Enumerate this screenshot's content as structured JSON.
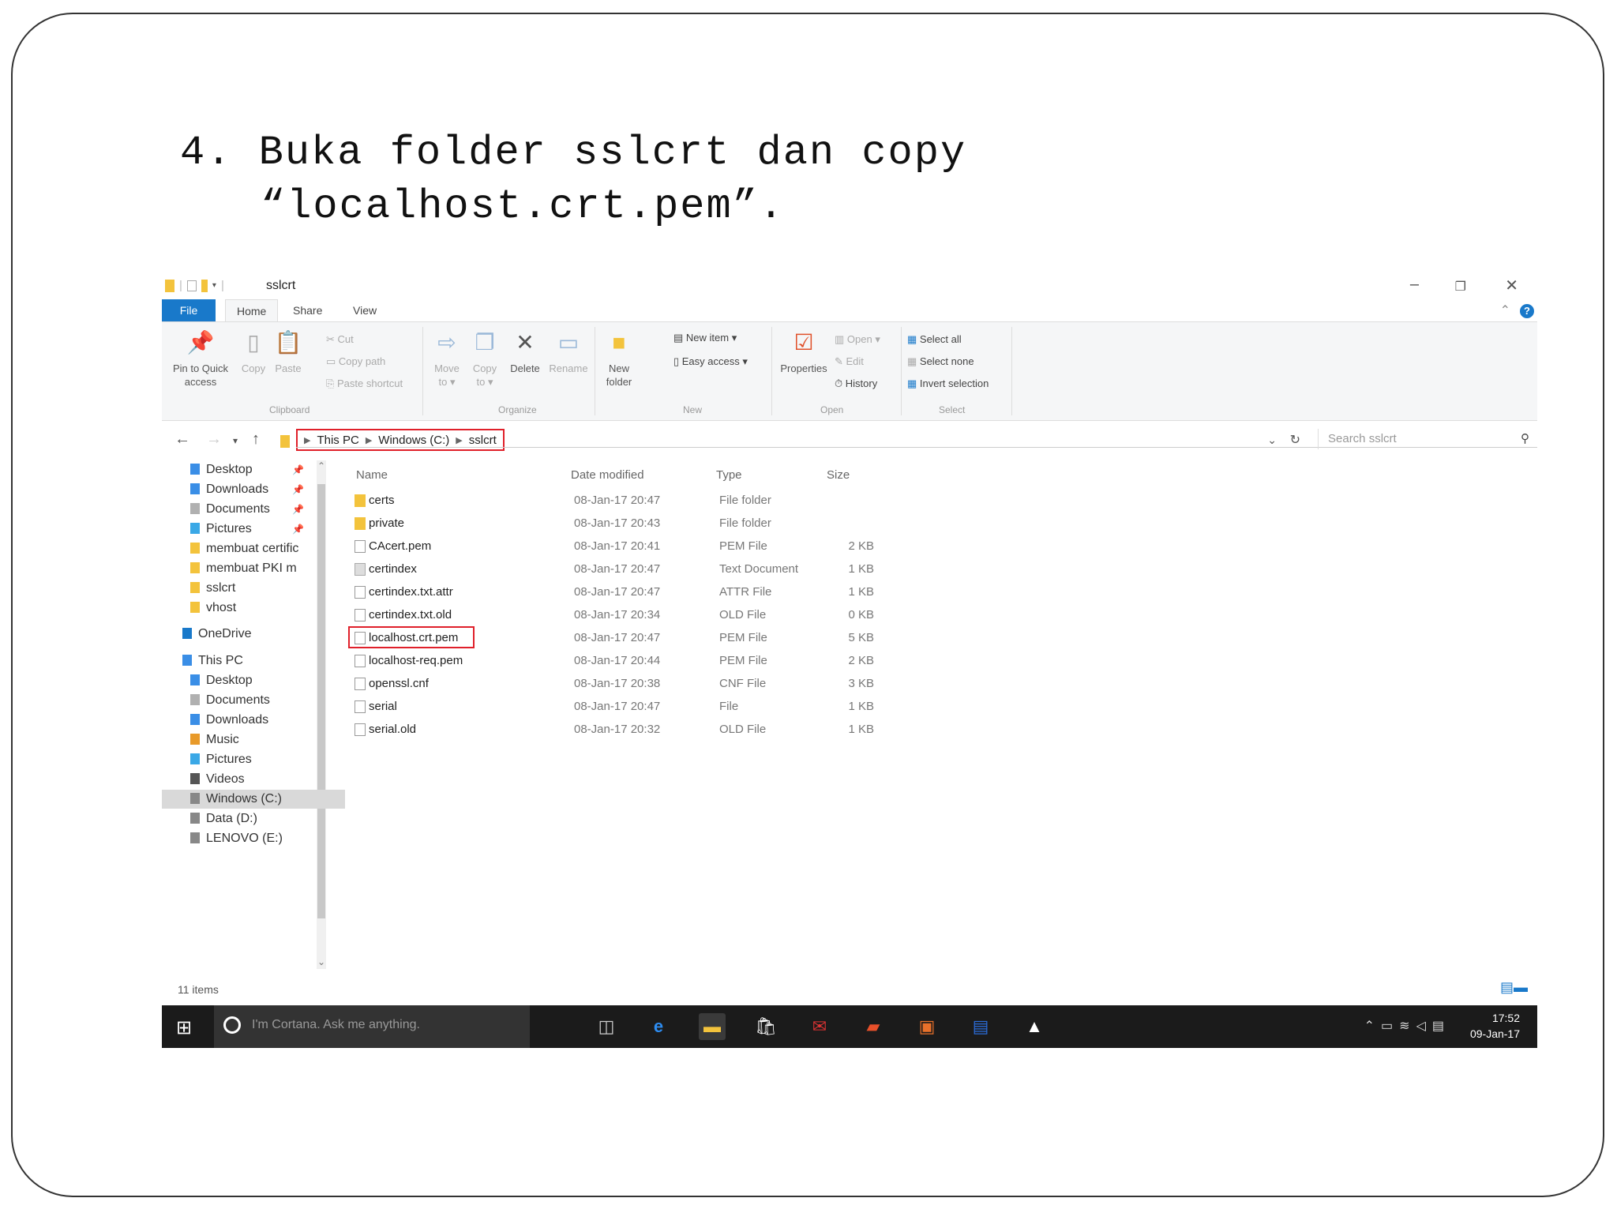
{
  "caption": {
    "line1": "4. Buka folder sslcrt dan copy",
    "line2": "“localhost.crt.pem”."
  },
  "window": {
    "title": "sslcrt",
    "controls": {
      "minimize": "–",
      "restore": "❐",
      "close": "✕"
    }
  },
  "ribbon": {
    "tabs": [
      "File",
      "Home",
      "Share",
      "View"
    ],
    "help": "?",
    "clipboard": {
      "pin": "Pin to Quick access",
      "copy": "Copy",
      "paste": "Paste",
      "cut": "Cut",
      "copy_path": "Copy path",
      "paste_shortcut": "Paste shortcut",
      "group": "Clipboard"
    },
    "organize": {
      "move_to": "Move to ▾",
      "copy_to": "Copy to ▾",
      "delete": "Delete",
      "rename": "Rename",
      "group": "Organize"
    },
    "new": {
      "new_folder": "New folder",
      "new_item": "New item ▾",
      "easy_access": "Easy access ▾",
      "group": "New"
    },
    "open": {
      "properties": "Properties",
      "open": "Open ▾",
      "edit": "Edit",
      "history": "History",
      "group": "Open"
    },
    "select": {
      "select_all": "Select all",
      "select_none": "Select none",
      "invert": "Invert selection",
      "group": "Select"
    }
  },
  "address": {
    "crumbs": [
      "This PC",
      "Windows (C:)",
      "sslcrt"
    ],
    "search_placeholder": "Search sslcrt"
  },
  "nav_pane": [
    {
      "label": "Desktop",
      "pinned": true,
      "icon": "desktop-icon"
    },
    {
      "label": "Downloads",
      "pinned": true,
      "icon": "downloads-icon"
    },
    {
      "label": "Documents",
      "pinned": true,
      "icon": "documents-icon"
    },
    {
      "label": "Pictures",
      "pinned": true,
      "icon": "pictures-icon"
    },
    {
      "label": "membuat certific",
      "pinned": false,
      "icon": "folder-icon"
    },
    {
      "label": "membuat PKI m",
      "pinned": false,
      "icon": "folder-icon"
    },
    {
      "label": "sslcrt",
      "pinned": false,
      "icon": "folder-icon"
    },
    {
      "label": "vhost",
      "pinned": false,
      "icon": "folder-icon"
    },
    {
      "label": "OneDrive",
      "pinned": false,
      "icon": "onedrive-icon"
    },
    {
      "label": "This PC",
      "pinned": false,
      "icon": "pc-icon"
    },
    {
      "label": "Desktop",
      "pinned": false,
      "icon": "desktop-icon"
    },
    {
      "label": "Documents",
      "pinned": false,
      "icon": "documents-icon"
    },
    {
      "label": "Downloads",
      "pinned": false,
      "icon": "downloads-icon"
    },
    {
      "label": "Music",
      "pinned": false,
      "icon": "music-icon"
    },
    {
      "label": "Pictures",
      "pinned": false,
      "icon": "pictures-icon"
    },
    {
      "label": "Videos",
      "pinned": false,
      "icon": "videos-icon"
    },
    {
      "label": "Windows (C:)",
      "pinned": false,
      "icon": "drive-icon",
      "selected": true
    },
    {
      "label": "Data (D:)",
      "pinned": false,
      "icon": "drive-icon"
    },
    {
      "label": "LENOVO (E:)",
      "pinned": false,
      "icon": "drive-icon"
    }
  ],
  "columns": [
    "Name",
    "Date modified",
    "Type",
    "Size"
  ],
  "files": [
    {
      "name": "certs",
      "date": "08-Jan-17 20:47",
      "type": "File folder",
      "size": "",
      "kind": "folder"
    },
    {
      "name": "private",
      "date": "08-Jan-17 20:43",
      "type": "File folder",
      "size": "",
      "kind": "folder"
    },
    {
      "name": "CAcert.pem",
      "date": "08-Jan-17 20:41",
      "type": "PEM File",
      "size": "2 KB",
      "kind": "file"
    },
    {
      "name": "certindex",
      "date": "08-Jan-17 20:47",
      "type": "Text Document",
      "size": "1 KB",
      "kind": "text"
    },
    {
      "name": "certindex.txt.attr",
      "date": "08-Jan-17 20:47",
      "type": "ATTR File",
      "size": "1 KB",
      "kind": "file"
    },
    {
      "name": "certindex.txt.old",
      "date": "08-Jan-17 20:34",
      "type": "OLD File",
      "size": "0 KB",
      "kind": "file"
    },
    {
      "name": "localhost.crt.pem",
      "date": "08-Jan-17 20:47",
      "type": "PEM File",
      "size": "5 KB",
      "kind": "file",
      "highlighted": true
    },
    {
      "name": "localhost-req.pem",
      "date": "08-Jan-17 20:44",
      "type": "PEM File",
      "size": "2 KB",
      "kind": "file"
    },
    {
      "name": "openssl.cnf",
      "date": "08-Jan-17 20:38",
      "type": "CNF File",
      "size": "3 KB",
      "kind": "file"
    },
    {
      "name": "serial",
      "date": "08-Jan-17 20:47",
      "type": "File",
      "size": "1 KB",
      "kind": "file"
    },
    {
      "name": "serial.old",
      "date": "08-Jan-17 20:32",
      "type": "OLD File",
      "size": "1 KB",
      "kind": "file"
    }
  ],
  "status": "11 items",
  "taskbar": {
    "cortana": "I'm Cortana. Ask me anything.",
    "apps": [
      "task-view-icon",
      "edge-icon",
      "file-explorer-icon",
      "store-icon",
      "mail-icon",
      "pdf-icon",
      "powerpoint-icon",
      "word-icon",
      "photos-icon"
    ],
    "time": "17:52",
    "date": "09-Jan-17"
  },
  "colors": {
    "accent": "#1979ca",
    "highlight": "#e0202a",
    "folder": "#f3c33c",
    "taskbar": "#1b1b1b"
  }
}
